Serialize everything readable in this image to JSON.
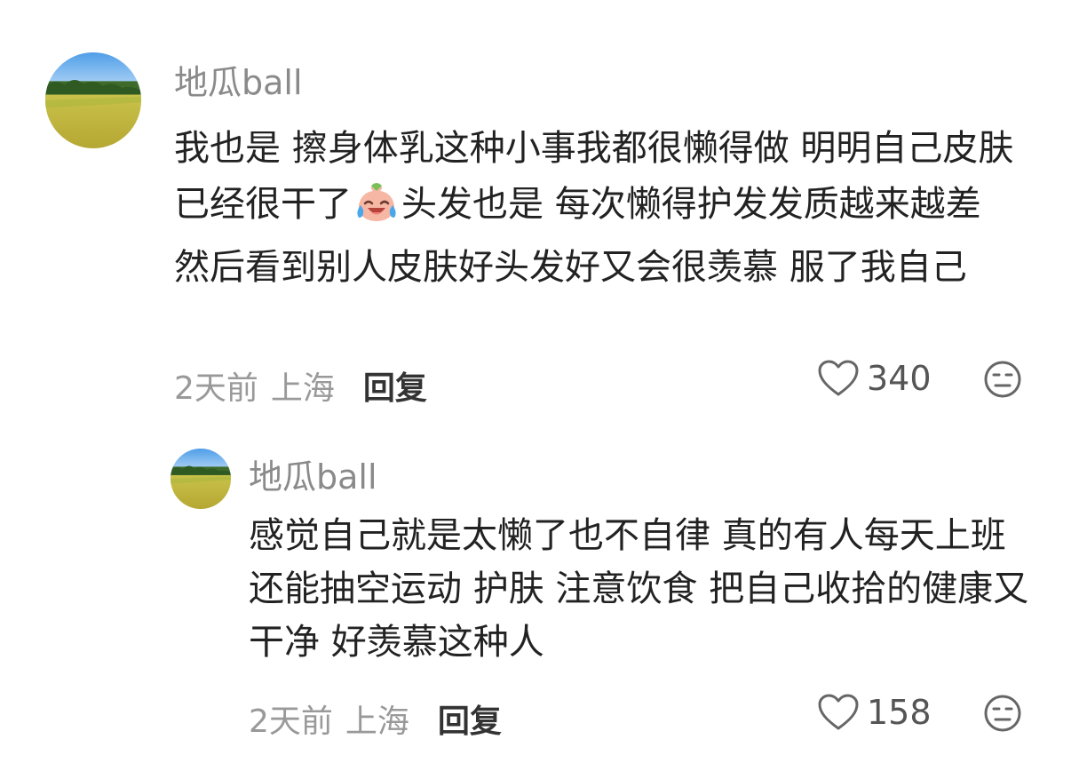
{
  "comments": [
    {
      "username": "地瓜ball",
      "avatar_icon": "field-landscape-avatar",
      "text_part1": "我也是 擦身体乳这种小事我都很懒得做 明明自己皮肤已经很干了",
      "emoji_icon": "crying-laughing-peach-emoji",
      "text_part2": "头发也是 每次懒得护发发质越来越差 然后看到别人皮肤好头发好又会很羡慕 服了我自己",
      "time": "2天前",
      "location": "上海",
      "reply_label": "回复",
      "like_count": "340"
    },
    {
      "username": "地瓜ball",
      "avatar_icon": "field-landscape-avatar",
      "text": "感觉自己就是太懒了也不自律 真的有人每天上班还能抽空运动 护肤 注意饮食 把自己收拾的健康又干净 好羡慕这种人",
      "time": "2天前",
      "location": "上海",
      "reply_label": "回复",
      "like_count": "158"
    }
  ],
  "colors": {
    "username": "#8a8a8a",
    "body_text": "#222222",
    "meta_text": "#999999",
    "reply": "#333333",
    "icon": "#666666"
  }
}
